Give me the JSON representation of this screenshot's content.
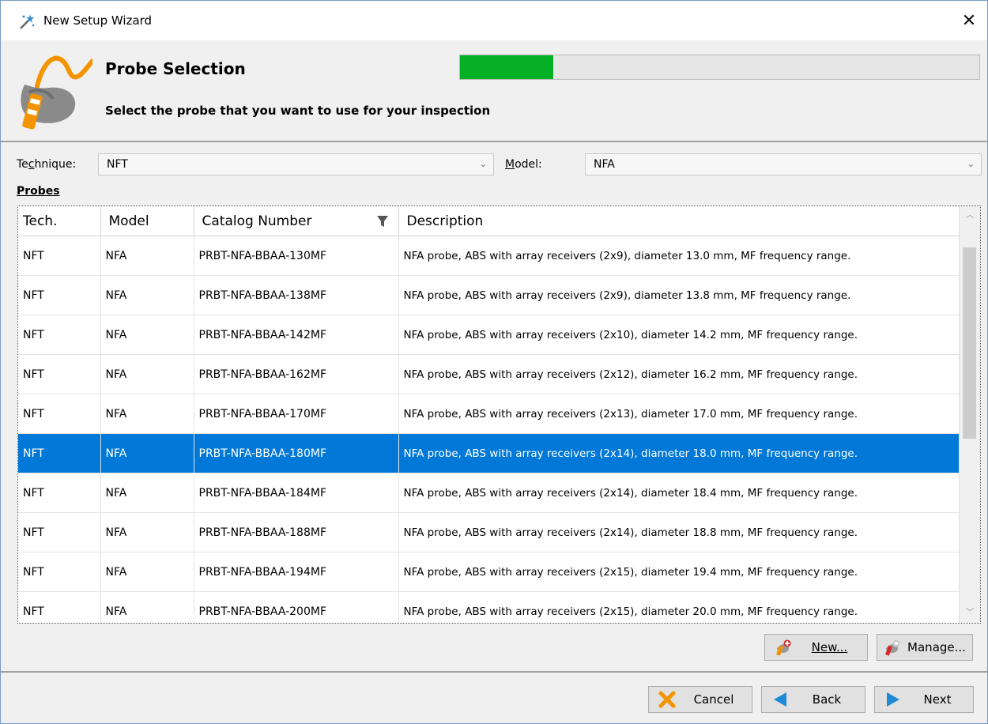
{
  "window": {
    "title": "New Setup Wizard",
    "close_glyph": "✕"
  },
  "header": {
    "step_title": "Probe Selection",
    "step_subtitle": "Select the probe that you want to use for your inspection",
    "progress_fraction": 0.18
  },
  "filters": {
    "technique_label": "Technique:",
    "technique_value": "NFT",
    "model_label": "Model:",
    "model_value": "NFA"
  },
  "probes_label": "Probes",
  "table": {
    "columns": [
      "Tech.",
      "Model",
      "Catalog Number",
      "Description"
    ],
    "selected_index": 5,
    "rows": [
      [
        "NFT",
        "NFA",
        "PRBT-NFA-BBAA-130MF",
        "NFA probe, ABS with array receivers (2x9), diameter 13.0 mm, MF frequency range."
      ],
      [
        "NFT",
        "NFA",
        "PRBT-NFA-BBAA-138MF",
        "NFA probe, ABS with array receivers (2x9), diameter 13.8 mm, MF frequency range."
      ],
      [
        "NFT",
        "NFA",
        "PRBT-NFA-BBAA-142MF",
        "NFA probe, ABS with array receivers (2x10), diameter 14.2 mm, MF frequency range."
      ],
      [
        "NFT",
        "NFA",
        "PRBT-NFA-BBAA-162MF",
        "NFA probe, ABS with array receivers (2x12), diameter 16.2 mm, MF frequency range."
      ],
      [
        "NFT",
        "NFA",
        "PRBT-NFA-BBAA-170MF",
        "NFA probe, ABS with array receivers (2x13), diameter 17.0 mm, MF frequency range."
      ],
      [
        "NFT",
        "NFA",
        "PRBT-NFA-BBAA-180MF",
        "NFA probe, ABS with array receivers (2x14), diameter 18.0 mm, MF frequency range."
      ],
      [
        "NFT",
        "NFA",
        "PRBT-NFA-BBAA-184MF",
        "NFA probe, ABS with array receivers (2x14), diameter 18.4 mm, MF frequency range."
      ],
      [
        "NFT",
        "NFA",
        "PRBT-NFA-BBAA-188MF",
        "NFA probe, ABS with array receivers (2x14), diameter 18.8 mm, MF frequency range."
      ],
      [
        "NFT",
        "NFA",
        "PRBT-NFA-BBAA-194MF",
        "NFA probe, ABS with array receivers (2x15), diameter 19.4 mm, MF frequency range."
      ],
      [
        "NFT",
        "NFA",
        "PRBT-NFA-BBAA-200MF",
        "NFA probe, ABS with array receivers (2x15), diameter 20.0 mm, MF frequency range."
      ]
    ]
  },
  "buttons": {
    "new_label": "New...",
    "manage_label": "Manage...",
    "cancel_label": "Cancel",
    "back_label": "Back",
    "next_label": "Next"
  },
  "colors": {
    "selection": "#0078d7",
    "progress": "#06b025"
  }
}
